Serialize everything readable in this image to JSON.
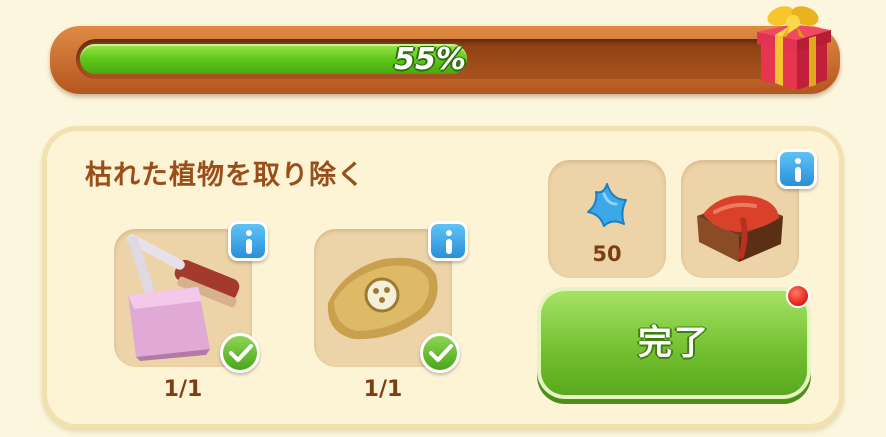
{
  "progress": {
    "percent_label": "55%",
    "fraction": 0.55,
    "fill_color": "#5ec81a",
    "reward_icon": "gift-box-icon"
  },
  "task": {
    "title": "枯れた植物を取り除く",
    "requirements": [
      {
        "icon": "dustpan-brush-icon",
        "count": "1/1",
        "complete": true,
        "info_icon": "info-icon"
      },
      {
        "icon": "sack-icon",
        "count": "1/1",
        "complete": true,
        "info_icon": "info-icon"
      }
    ],
    "rewards": [
      {
        "icon": "blue-star-icon",
        "amount": "50"
      },
      {
        "icon": "red-cloth-crate-icon",
        "info_icon": "info-icon"
      }
    ],
    "complete_button": {
      "label": "完了",
      "color": "#74c232",
      "notification_icon": "red-dot-icon"
    }
  }
}
